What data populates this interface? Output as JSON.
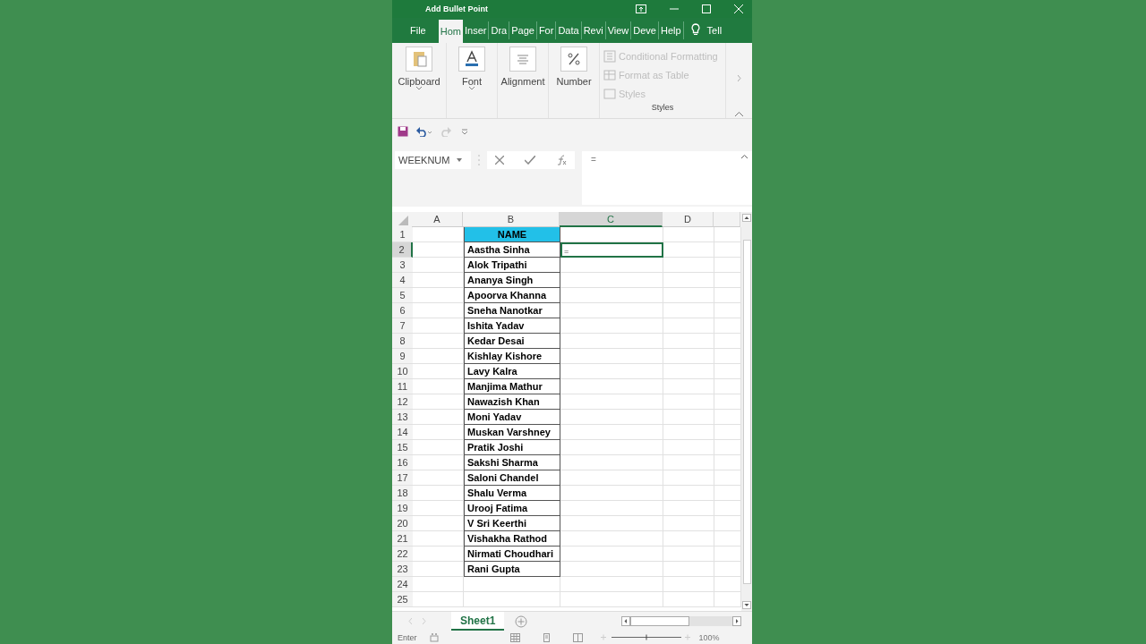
{
  "window": {
    "title": "Add Bullet Point"
  },
  "tabs": [
    {
      "label": "File",
      "selected": false
    },
    {
      "label": "Hom",
      "selected": true
    },
    {
      "label": "Inser",
      "selected": false
    },
    {
      "label": "Dra",
      "selected": false
    },
    {
      "label": "Page",
      "selected": false
    },
    {
      "label": "For",
      "selected": false
    },
    {
      "label": "Data",
      "selected": false
    },
    {
      "label": "Revi",
      "selected": false
    },
    {
      "label": "View",
      "selected": false
    },
    {
      "label": "Deve",
      "selected": false
    },
    {
      "label": "Help",
      "selected": false
    }
  ],
  "tell_me": "Tell",
  "ribbon": {
    "groups": [
      {
        "label": "Clipboard",
        "kind": "clipboard"
      },
      {
        "label": "Font",
        "kind": "font"
      },
      {
        "label": "Alignment",
        "kind": "alignment"
      },
      {
        "label": "Number",
        "kind": "number"
      }
    ],
    "styles": {
      "items": [
        {
          "label": "Conditional Formatting",
          "kind": "conditional"
        },
        {
          "label": "Format as Table",
          "kind": "table"
        },
        {
          "label": "Styles",
          "kind": "cellstyles"
        }
      ],
      "label": "Styles"
    }
  },
  "name_box": "WEEKNUM",
  "formula": "=",
  "columns": [
    {
      "label": "A",
      "selected": false
    },
    {
      "label": "B",
      "selected": false
    },
    {
      "label": "C",
      "selected": true
    },
    {
      "label": "D",
      "selected": false
    }
  ],
  "rows": [
    {
      "number": "1",
      "name": "NAME",
      "kind": "header",
      "selected": false
    },
    {
      "number": "2",
      "name": "Aastha Sinha",
      "kind": "data",
      "selected": true,
      "entry": "="
    },
    {
      "number": "3",
      "name": "Alok Tripathi",
      "kind": "data",
      "selected": false
    },
    {
      "number": "4",
      "name": "Ananya Singh",
      "kind": "data",
      "selected": false
    },
    {
      "number": "5",
      "name": "Apoorva Khanna",
      "kind": "data",
      "selected": false
    },
    {
      "number": "6",
      "name": "Sneha Nanotkar",
      "kind": "data",
      "selected": false
    },
    {
      "number": "7",
      "name": "Ishita Yadav",
      "kind": "data",
      "selected": false
    },
    {
      "number": "8",
      "name": "Kedar Desai",
      "kind": "data",
      "selected": false
    },
    {
      "number": "9",
      "name": "Kishlay Kishore",
      "kind": "data",
      "selected": false
    },
    {
      "number": "10",
      "name": "Lavy Kalra",
      "kind": "data",
      "selected": false
    },
    {
      "number": "11",
      "name": "Manjima Mathur",
      "kind": "data",
      "selected": false
    },
    {
      "number": "12",
      "name": "Nawazish Khan",
      "kind": "data",
      "selected": false
    },
    {
      "number": "13",
      "name": "Moni Yadav",
      "kind": "data",
      "selected": false
    },
    {
      "number": "14",
      "name": "Muskan Varshney",
      "kind": "data",
      "selected": false
    },
    {
      "number": "15",
      "name": "Pratik Joshi",
      "kind": "data",
      "selected": false
    },
    {
      "number": "16",
      "name": "Sakshi Sharma",
      "kind": "data",
      "selected": false
    },
    {
      "number": "17",
      "name": "Saloni Chandel",
      "kind": "data",
      "selected": false
    },
    {
      "number": "18",
      "name": "Shalu Verma",
      "kind": "data",
      "selected": false
    },
    {
      "number": "19",
      "name": "Urooj Fatima",
      "kind": "data",
      "selected": false
    },
    {
      "number": "20",
      "name": "V Sri Keerthi",
      "kind": "data",
      "selected": false
    },
    {
      "number": "21",
      "name": "Vishakha Rathod",
      "kind": "data",
      "selected": false
    },
    {
      "number": "22",
      "name": "Nirmati Choudhari",
      "kind": "data",
      "selected": false
    },
    {
      "number": "23",
      "name": "Rani Gupta",
      "kind": "data",
      "selected": false
    },
    {
      "number": "24",
      "kind": "empty",
      "selected": false
    },
    {
      "number": "25",
      "kind": "empty",
      "selected": false
    }
  ],
  "sheets": [
    {
      "label": "Sheet1",
      "selected": true
    }
  ],
  "status_bar": {
    "mode": "Enter",
    "zoom": "100%"
  }
}
